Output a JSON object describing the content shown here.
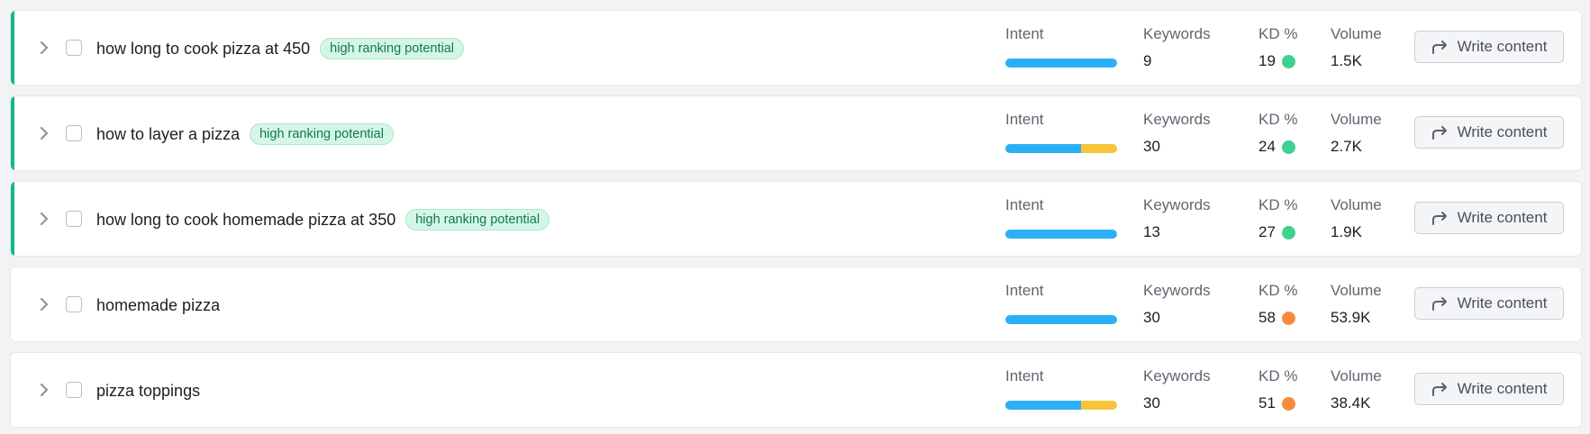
{
  "columns": {
    "intent": "Intent",
    "keywords": "Keywords",
    "kd": "KD %",
    "volume": "Volume"
  },
  "write_label": "Write content",
  "colors": {
    "accent": "#14b88a",
    "intent_blue": "#2bb0f5",
    "intent_yellow": "#f8c43a",
    "kd_easy": "#3fd18f",
    "kd_hard": "#f78b3d"
  },
  "rows": [
    {
      "title": "how long to cook pizza at 450",
      "badge": "high ranking potential",
      "keywords": "9",
      "kd": "19",
      "kd_color": "#3fd18f",
      "volume": "1.5K",
      "intent_blue_fraction": 1.0,
      "intent_yellow_fraction": 0.0,
      "accent": true
    },
    {
      "title": "how to layer a pizza",
      "badge": "high ranking potential",
      "keywords": "30",
      "kd": "24",
      "kd_color": "#3fd18f",
      "volume": "2.7K",
      "intent_blue_fraction": 0.68,
      "intent_yellow_fraction": 0.32,
      "accent": true
    },
    {
      "title": "how long to cook homemade pizza at 350",
      "badge": "high ranking potential",
      "keywords": "13",
      "kd": "27",
      "kd_color": "#3fd18f",
      "volume": "1.9K",
      "intent_blue_fraction": 1.0,
      "intent_yellow_fraction": 0.0,
      "accent": true
    },
    {
      "title": "homemade pizza",
      "badge": "",
      "keywords": "30",
      "kd": "58",
      "kd_color": "#f78b3d",
      "volume": "53.9K",
      "intent_blue_fraction": 1.0,
      "intent_yellow_fraction": 0.0,
      "accent": false
    },
    {
      "title": "pizza toppings",
      "badge": "",
      "keywords": "30",
      "kd": "51",
      "kd_color": "#f78b3d",
      "volume": "38.4K",
      "intent_blue_fraction": 0.68,
      "intent_yellow_fraction": 0.32,
      "accent": false
    }
  ]
}
